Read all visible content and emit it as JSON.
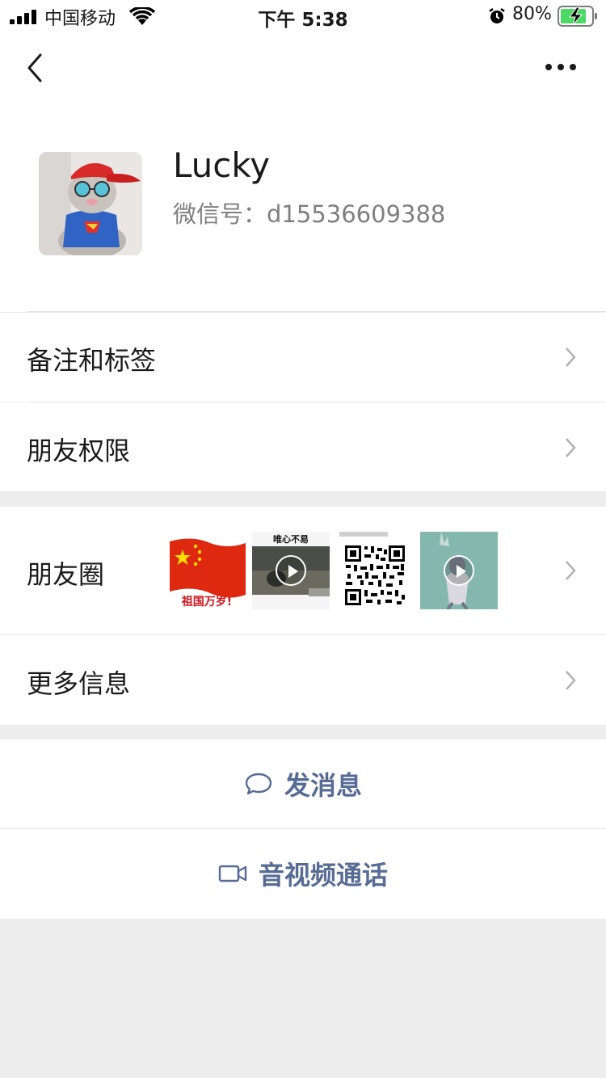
{
  "status_bar": {
    "carrier": "中国移动",
    "time": "下午 5:38",
    "battery": "80%"
  },
  "profile": {
    "name": "Lucky",
    "wechat_id": "微信号：d15536609388"
  },
  "menu": {
    "remarks": "备注和标签",
    "permissions": "朋友权限",
    "moments": "朋友圈",
    "more_info": "更多信息"
  },
  "moments_thumbs": {
    "flag_caption": "祖国万岁!",
    "video1_caption": "唯心不易"
  },
  "actions": {
    "message": "发消息",
    "video_call": "音视频通话"
  },
  "colors": {
    "link_blue": "#576b95",
    "background": "#ededed",
    "battery_green": "#4cd964"
  }
}
